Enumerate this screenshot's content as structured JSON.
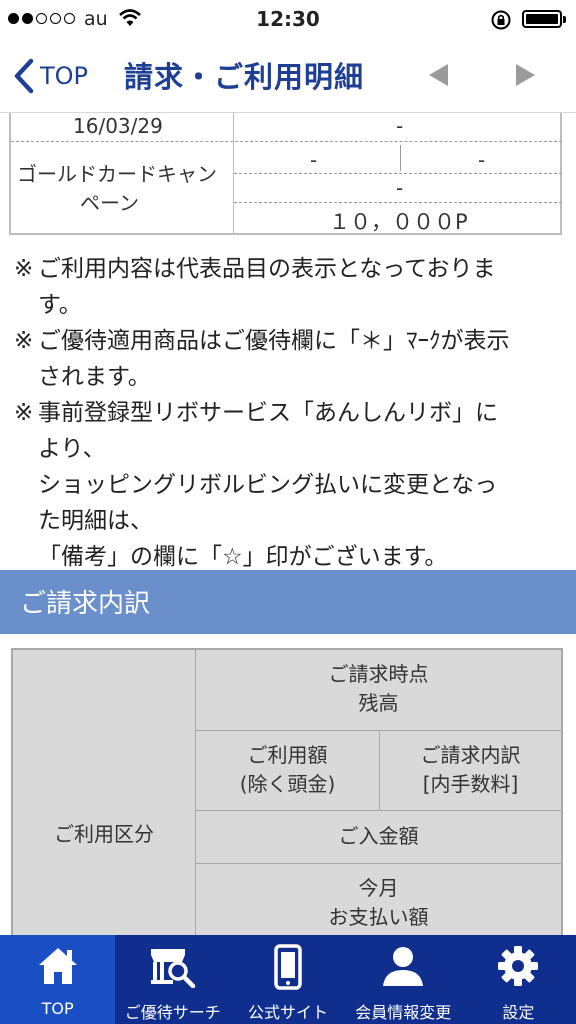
{
  "status_bar": {
    "carrier": "au",
    "time": "12:30"
  },
  "nav": {
    "back_label": "TOP",
    "title": "請求・ご利用明細"
  },
  "detail_table": {
    "date": "16/03/29",
    "date_value": "-",
    "campaign_name_line1": "ゴールドカードキャン",
    "campaign_name_line2": "ペーン",
    "value_a": "-",
    "value_b": "-",
    "value_c": "-",
    "points": "１０，０００P"
  },
  "notes": [
    {
      "mark": "※",
      "lines": [
        "ご利用内容は代表品目の表示となっておりま",
        "す。"
      ]
    },
    {
      "mark": "※",
      "lines": [
        "ご優待適用商品はご優待欄に「＊」ﾏｰｸが表示",
        "されます。"
      ]
    },
    {
      "mark": "※",
      "lines": [
        "事前登録型リボサービス「あんしんリボ」に",
        "より、",
        "ショッピングリボルビング払いに変更となっ",
        "た明細は、",
        "「備考」の欄に「☆」印がございます。"
      ]
    }
  ],
  "section": {
    "title": "ご請求内訳"
  },
  "breakdown": {
    "category_header": "ご利用区分",
    "balance_header_line1": "ご請求時点",
    "balance_header_line2": "残高",
    "amount_header_line1": "ご利用額",
    "amount_header_line2": "(除く頭金)",
    "detail_header_line1": "ご請求内訳",
    "detail_header_line2": "[内手数料]",
    "deposit_header": "ご入金額",
    "payment_header_line1": "今月",
    "payment_header_line2": "お支払い額"
  },
  "tabbar": {
    "tabs": [
      {
        "label": "TOP",
        "icon": "home-icon"
      },
      {
        "label": "ご優待サーチ",
        "icon": "store-search-icon"
      },
      {
        "label": "公式サイト",
        "icon": "smartphone-icon"
      },
      {
        "label": "会員情報変更",
        "icon": "user-icon"
      },
      {
        "label": "設定",
        "icon": "gear-icon"
      }
    ]
  },
  "colors": {
    "nav_text": "#1e3f93",
    "section_header": "#6a8fcb",
    "tabbar": "#0f2e8e",
    "tab_active": "#1a4fc4"
  }
}
